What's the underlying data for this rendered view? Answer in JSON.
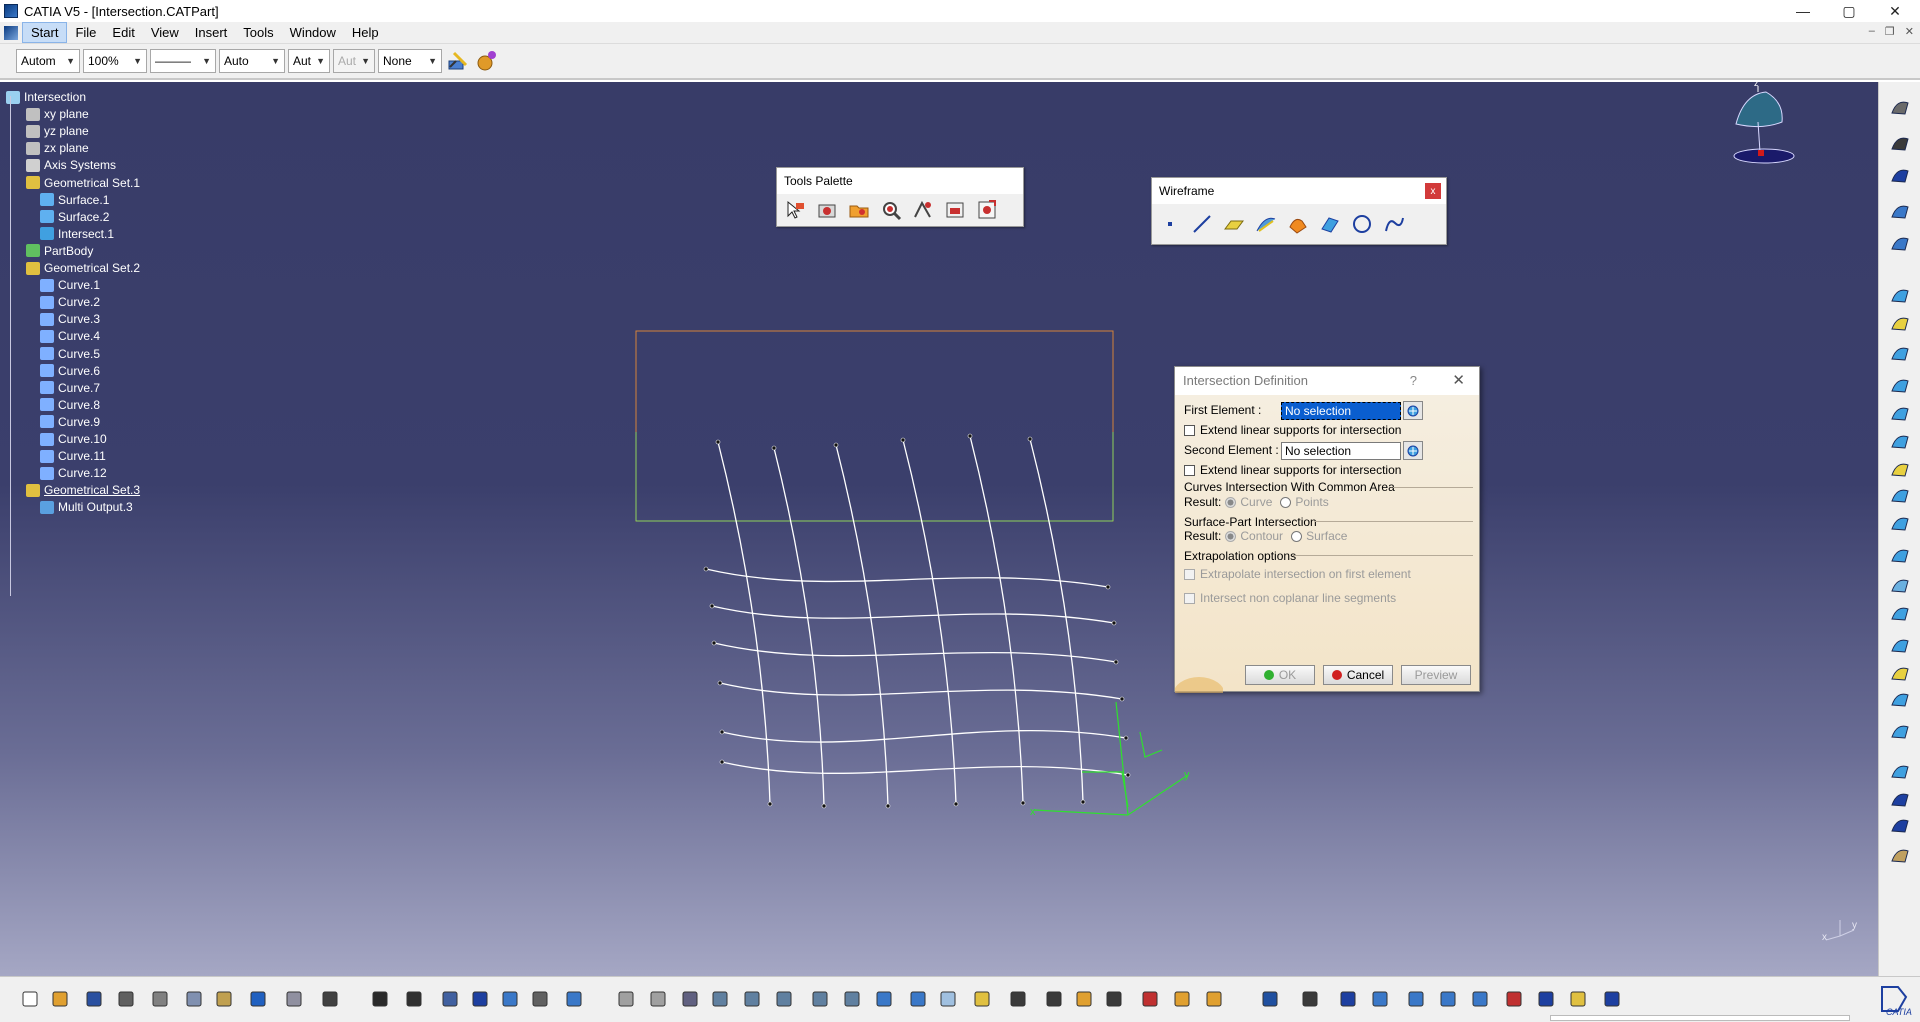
{
  "window": {
    "title": "CATIA V5 - [Intersection.CATPart]",
    "controls": {
      "minimize": "—",
      "maximize": "▢",
      "close": "✕"
    }
  },
  "menu": {
    "items": [
      {
        "label": "Start",
        "active": true
      },
      {
        "label": "File"
      },
      {
        "label": "Edit"
      },
      {
        "label": "View"
      },
      {
        "label": "Insert"
      },
      {
        "label": "Tools"
      },
      {
        "label": "Window"
      },
      {
        "label": "Help"
      }
    ],
    "mdi_controls": {
      "minimize": "–",
      "restore": "❐",
      "close": "✕"
    }
  },
  "properties_toolbar": {
    "color": "Autom",
    "transparency": "100%",
    "linetype": "———",
    "thickness": "Auto",
    "point_symbol": "Aut",
    "layer_disabled": "Aut",
    "layer": "None"
  },
  "tree": {
    "nodes": [
      {
        "label": "Intersection",
        "icon": "part-icon"
      },
      {
        "label": "xy plane",
        "icon": "plane-icon"
      },
      {
        "label": "yz plane",
        "icon": "plane-icon"
      },
      {
        "label": "zx plane",
        "icon": "plane-icon"
      },
      {
        "label": "Axis Systems",
        "icon": "axis-system-icon"
      },
      {
        "label": "Geometrical Set.1",
        "icon": "geometrical-set-icon"
      },
      {
        "label": "Surface.1",
        "icon": "surface-icon"
      },
      {
        "label": "Surface.2",
        "icon": "surface-icon"
      },
      {
        "label": "Intersect.1",
        "icon": "intersect-icon"
      },
      {
        "label": "PartBody",
        "icon": "partbody-icon"
      },
      {
        "label": "Geometrical Set.2",
        "icon": "geometrical-set-icon"
      },
      {
        "label": "Curve.1",
        "icon": "curve-icon"
      },
      {
        "label": "Curve.2",
        "icon": "curve-icon"
      },
      {
        "label": "Curve.3",
        "icon": "curve-icon"
      },
      {
        "label": "Curve.4",
        "icon": "curve-icon"
      },
      {
        "label": "Curve.5",
        "icon": "curve-icon"
      },
      {
        "label": "Curve.6",
        "icon": "curve-icon"
      },
      {
        "label": "Curve.7",
        "icon": "curve-icon"
      },
      {
        "label": "Curve.8",
        "icon": "curve-icon"
      },
      {
        "label": "Curve.9",
        "icon": "curve-icon"
      },
      {
        "label": "Curve.10",
        "icon": "curve-icon"
      },
      {
        "label": "Curve.11",
        "icon": "curve-icon"
      },
      {
        "label": "Curve.12",
        "icon": "curve-icon"
      },
      {
        "label": "Geometrical Set.3",
        "icon": "geometrical-set-icon",
        "underline": true
      },
      {
        "label": "Multi Output.3",
        "icon": "multi-output-icon"
      }
    ]
  },
  "tools_palette": {
    "title": "Tools Palette"
  },
  "wireframe_toolbar": {
    "title": "Wireframe",
    "close": "x"
  },
  "dialog": {
    "title": "Intersection Definition",
    "help": "?",
    "close": "✕",
    "first_element_label": "First Element :",
    "first_element_value": "No selection",
    "extend1_label": "Extend linear supports for intersection",
    "second_element_label": "Second Element :",
    "second_element_value": "No selection",
    "extend2_label": "Extend linear supports for intersection",
    "curves_section": "Curves Intersection With Common Area",
    "result_label_1": "Result:",
    "curve_option": "Curve",
    "points_option": "Points",
    "surface_section": "Surface-Part Intersection",
    "result_label_2": "Result:",
    "contour_option": "Contour",
    "surface_option": "Surface",
    "extrapolation_section": "Extrapolation options",
    "extrapolate_label": "Extrapolate intersection on first element",
    "intersect_noncoplanar_label": "Intersect non coplanar line segments",
    "ok_label": "OK",
    "cancel_label": "Cancel",
    "preview_label": "Preview"
  },
  "compass": {
    "z_label": "z"
  },
  "axis_triad": {
    "y_label": "y",
    "x_label": "x"
  },
  "colors": {
    "viewport_top": "#383c68",
    "viewport_bottom": "#a5a7c4",
    "curve_white": "#ffffff",
    "bbox_green": "#8fd15a",
    "bbox_orange": "#d4823a",
    "axis_green": "#2fe02f"
  }
}
